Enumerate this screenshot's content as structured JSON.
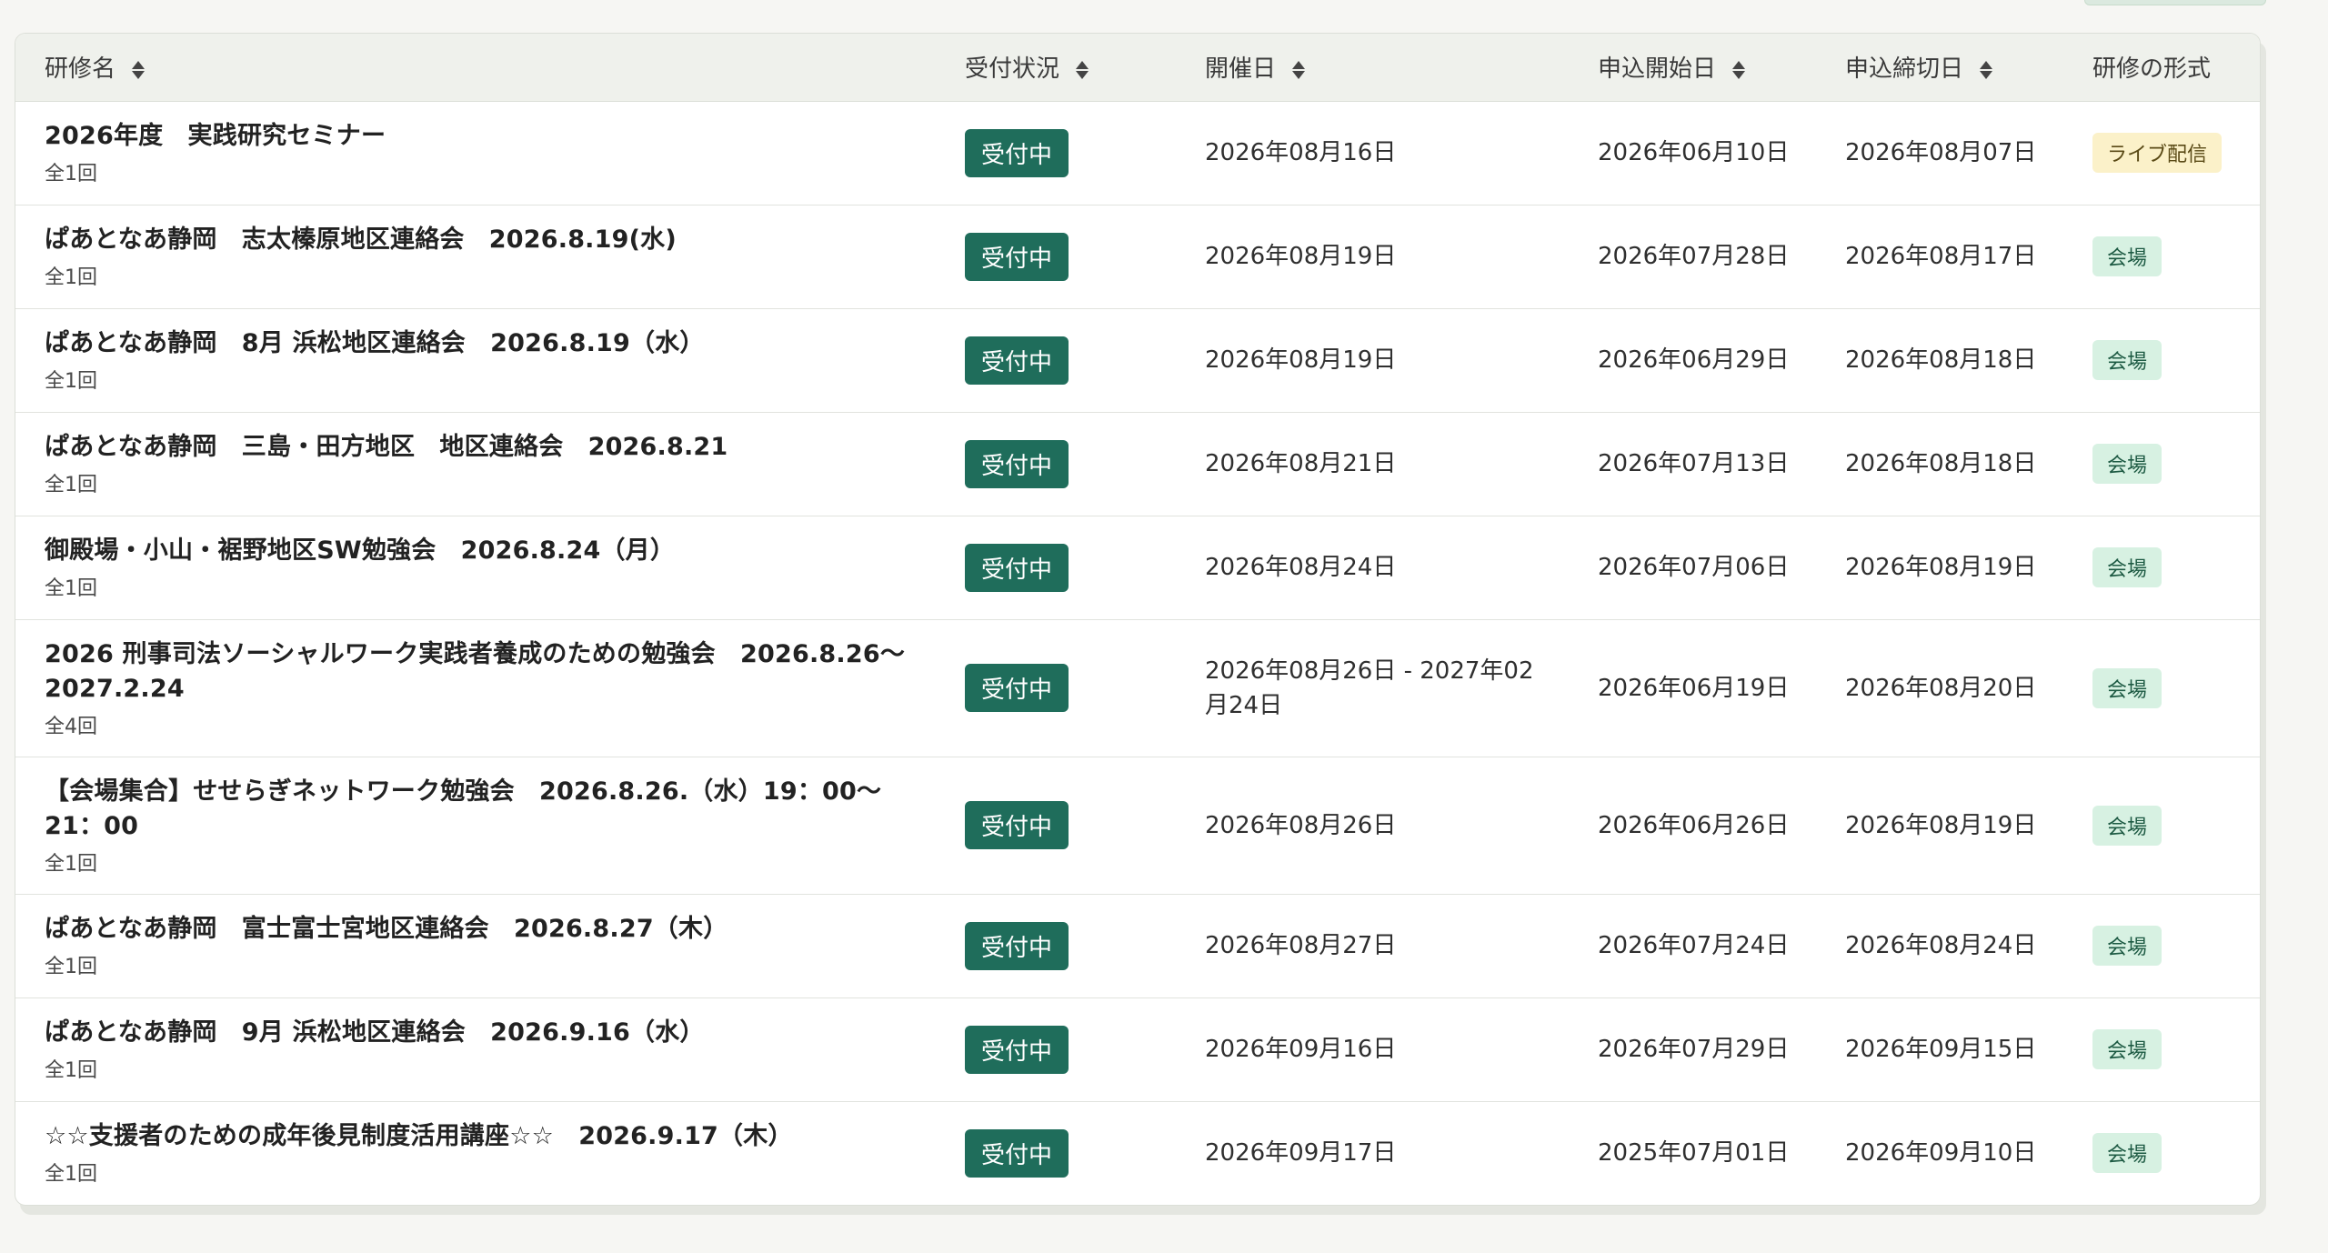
{
  "table": {
    "headers": {
      "course_name": "研修名",
      "status": "受付状況",
      "event_date": "開催日",
      "apply_start": "申込開始日",
      "apply_end": "申込締切日",
      "format": "研修の形式"
    },
    "rows": [
      {
        "title": "2026年度　実践研究セミナー",
        "count": "全1回",
        "status": "受付中",
        "event_date": "2026年08月16日",
        "apply_start": "2026年06月10日",
        "apply_end": "2026年08月07日",
        "format": "ライブ配信"
      },
      {
        "title": "ぱあとなあ静岡　志太榛原地区連絡会　2026.8.19(水)",
        "count": "全1回",
        "status": "受付中",
        "event_date": "2026年08月19日",
        "apply_start": "2026年07月28日",
        "apply_end": "2026年08月17日",
        "format": "会場"
      },
      {
        "title": "ぱあとなあ静岡　8月 浜松地区連絡会　2026.8.19（水）",
        "count": "全1回",
        "status": "受付中",
        "event_date": "2026年08月19日",
        "apply_start": "2026年06月29日",
        "apply_end": "2026年08月18日",
        "format": "会場"
      },
      {
        "title": "ぱあとなあ静岡　三島・田方地区　地区連絡会　2026.8.21",
        "count": "全1回",
        "status": "受付中",
        "event_date": "2026年08月21日",
        "apply_start": "2026年07月13日",
        "apply_end": "2026年08月18日",
        "format": "会場"
      },
      {
        "title": "御殿場・小山・裾野地区SW勉強会　2026.8.24（月）",
        "count": "全1回",
        "status": "受付中",
        "event_date": "2026年08月24日",
        "apply_start": "2026年07月06日",
        "apply_end": "2026年08月19日",
        "format": "会場"
      },
      {
        "title": "2026 刑事司法ソーシャルワーク実践者養成のための勉強会　2026.8.26～2027.2.24",
        "count": "全4回",
        "status": "受付中",
        "event_date": "2026年08月26日 - 2027年02月24日",
        "apply_start": "2026年06月19日",
        "apply_end": "2026年08月20日",
        "format": "会場"
      },
      {
        "title": "【会場集合】せせらぎネットワーク勉強会　2026.8.26.（水）19：00～21：00",
        "count": "全1回",
        "status": "受付中",
        "event_date": "2026年08月26日",
        "apply_start": "2026年06月26日",
        "apply_end": "2026年08月19日",
        "format": "会場"
      },
      {
        "title": "ぱあとなあ静岡　富士富士宮地区連絡会　2026.8.27（木）",
        "count": "全1回",
        "status": "受付中",
        "event_date": "2026年08月27日",
        "apply_start": "2026年07月24日",
        "apply_end": "2026年08月24日",
        "format": "会場"
      },
      {
        "title": "ぱあとなあ静岡　9月 浜松地区連絡会　2026.9.16（水）",
        "count": "全1回",
        "status": "受付中",
        "event_date": "2026年09月16日",
        "apply_start": "2026年07月29日",
        "apply_end": "2026年09月15日",
        "format": "会場"
      },
      {
        "title": "☆☆支援者のための成年後見制度活用講座☆☆　2026.9.17（木）",
        "count": "全1回",
        "status": "受付中",
        "event_date": "2026年09月17日",
        "apply_start": "2025年07月01日",
        "apply_end": "2026年09月10日",
        "format": "会場"
      }
    ]
  },
  "colors": {
    "status_badge": "#1f6d5b",
    "venue_badge_bg": "#d7f1e2",
    "live_badge_bg": "#fbf1c9",
    "header_bg": "#eff1ec"
  },
  "icons": {
    "sort": "sort-updown-icon"
  }
}
